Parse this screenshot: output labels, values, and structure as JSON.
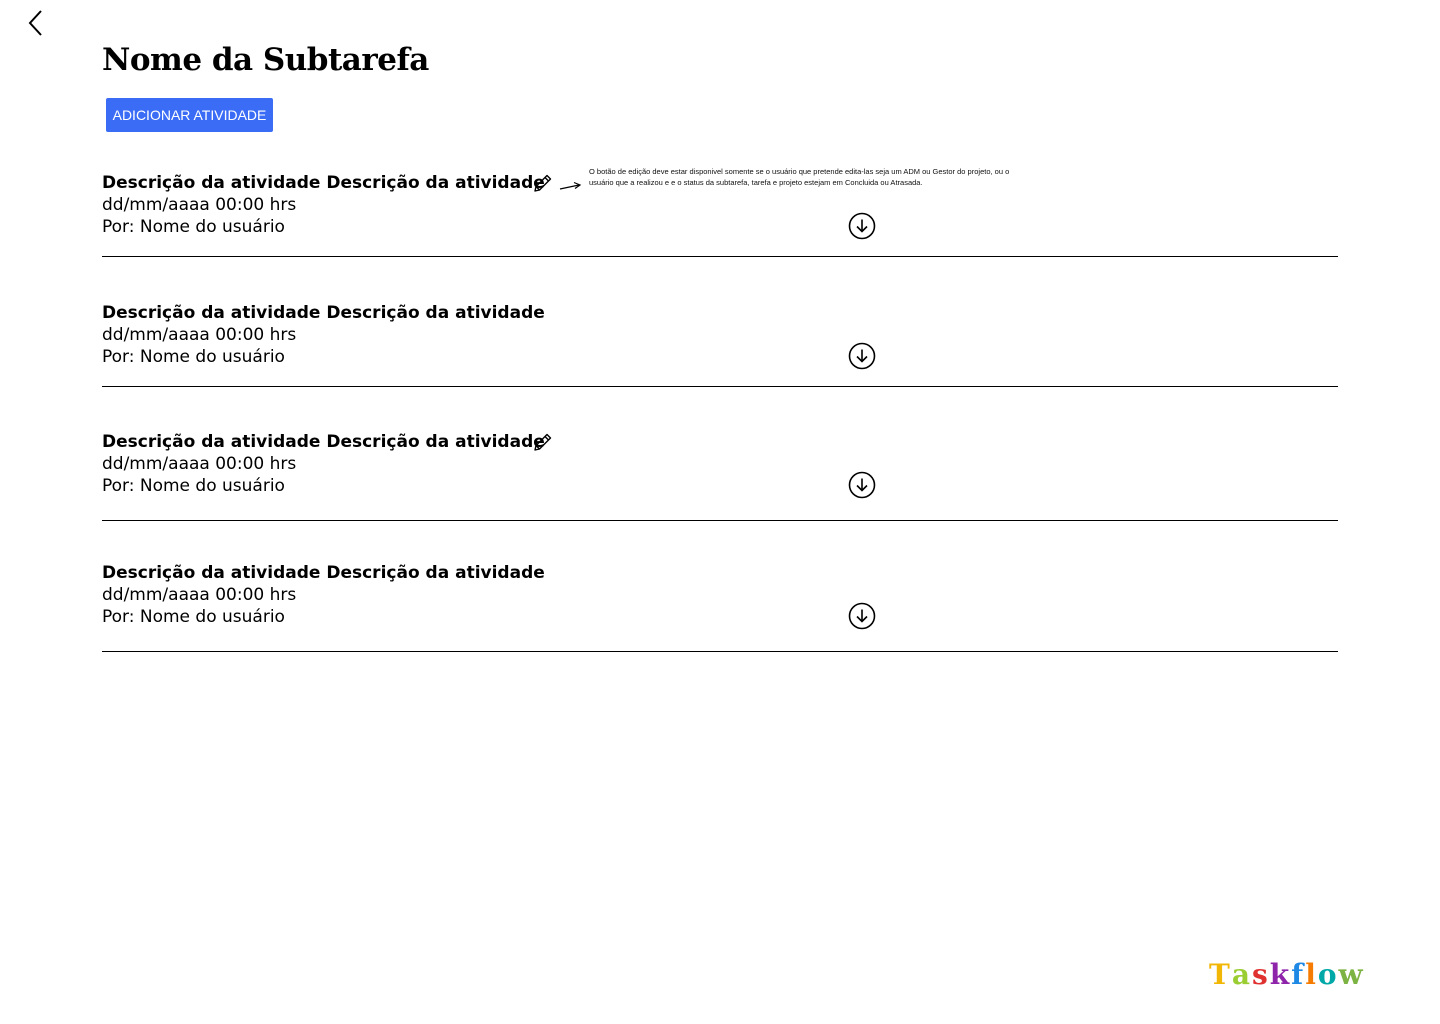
{
  "header": {
    "back_icon": "chevron-left-icon",
    "title": "Nome da Subtarefa",
    "add_button_label": "ADICIONAR ATIVIDADE",
    "add_button_color": "#3b6cf6"
  },
  "activities": [
    {
      "description": "Descrição da atividade Descrição da atividade",
      "datetime": "dd/mm/aaaa 00:00 hrs",
      "user": "Por: Nome do usuário",
      "editable": true
    },
    {
      "description": "Descrição da atividade Descrição da atividade",
      "datetime": "dd/mm/aaaa 00:00 hrs",
      "user": "Por: Nome do usuário",
      "editable": false
    },
    {
      "description": "Descrição da atividade Descrição da atividade",
      "datetime": "dd/mm/aaaa 00:00 hrs",
      "user": "Por: Nome do usuário",
      "editable": true
    },
    {
      "description": "Descrição da atividade Descrição da atividade",
      "datetime": "dd/mm/aaaa 00:00 hrs",
      "user": "Por: Nome do usuário",
      "editable": false
    }
  ],
  "annotation": {
    "text": "O botão de  edição deve estar disponivel somente se o usuário que pretende edita-las seja um ADM ou Gestor do projeto, ou o usuário que a realizou e e o status da subtarefa, tarefa e projeto estejam em Concluida ou Atrasada."
  },
  "brand": {
    "name": "Taskflow",
    "letter_colors": [
      "#f2b705",
      "#9acd32",
      "#e03131",
      "#8e24aa",
      "#1e88e5",
      "#f57c00",
      "#00a8a8",
      "#7cb342"
    ]
  },
  "icons": {
    "edit": "pencil-icon",
    "download": "download-circle-icon",
    "arrow": "arrow-right-icon"
  }
}
